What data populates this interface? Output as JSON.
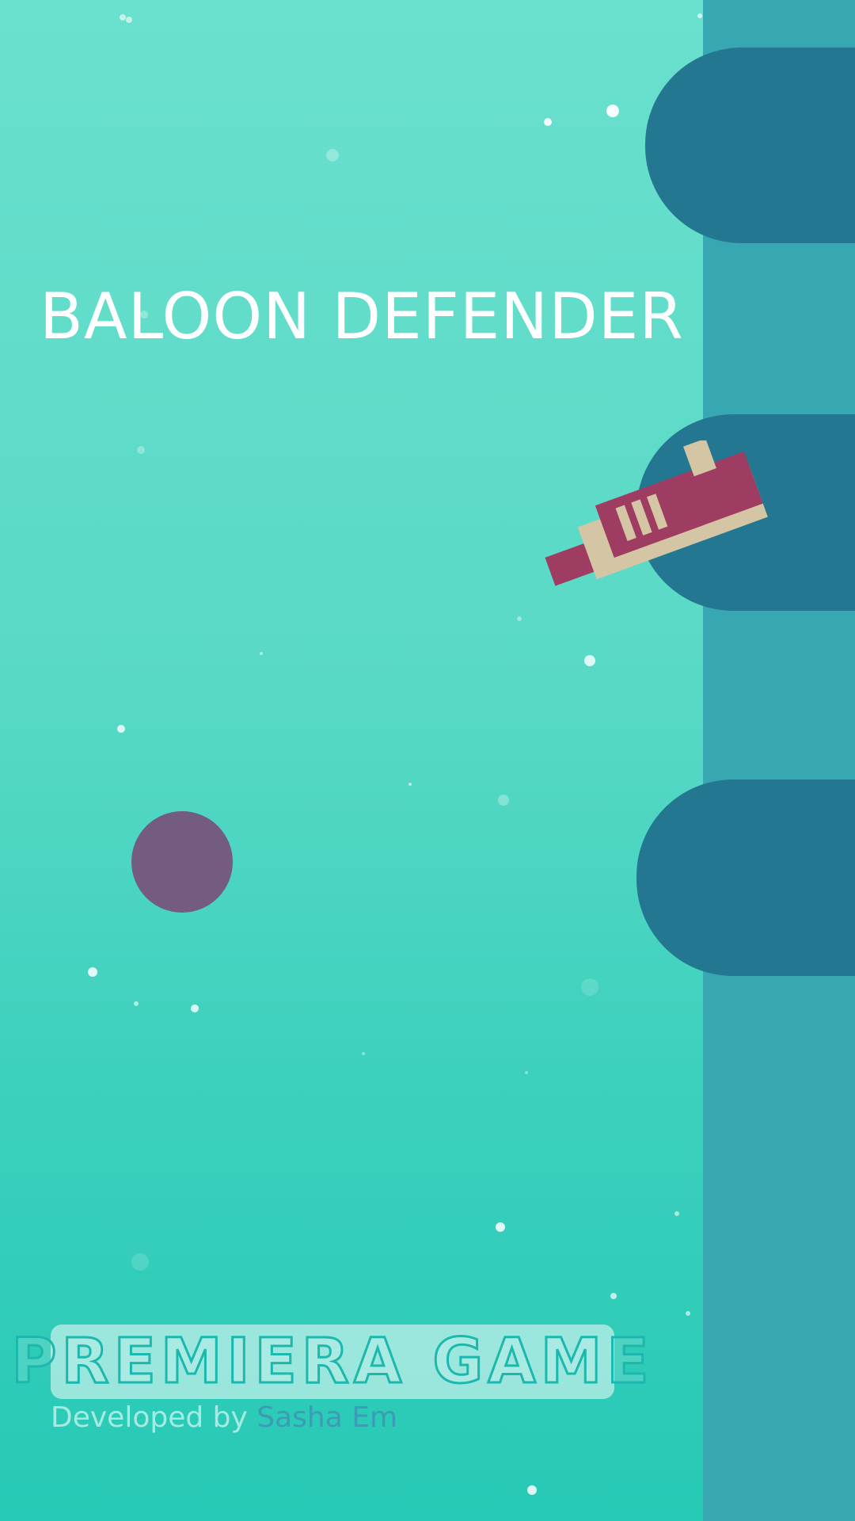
{
  "game": {
    "title": "BALOON DEFENDER"
  },
  "branding": {
    "logo_text": "PREMIERA GAME",
    "developed_by_prefix": "Developed by",
    "developer_name": "Sasha Em"
  },
  "colors": {
    "background_top": "#6ae0ce",
    "background_bottom": "#26c9b5",
    "wall": "#37a8b2",
    "pillar": "#247790",
    "balloon": "#735c80",
    "gun_body": "#9f3c62",
    "gun_trim": "#d4c6a4"
  },
  "icons": {
    "player": "gun-icon",
    "enemy": "balloon-icon"
  }
}
